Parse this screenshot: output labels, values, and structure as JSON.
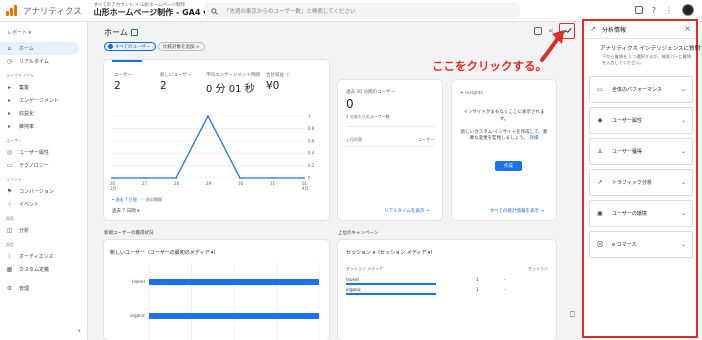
{
  "topbar": {
    "app_name": "アナリティクス",
    "breadcrumb_top": "すべてのアカウント > 山形ホームページ制作",
    "property": "山形ホームページ制作 - GA4 ▾",
    "search_placeholder": "「先週の東京からのユーザー数」と検索してください"
  },
  "sidebar": {
    "report_label": "レポート ▾",
    "items_top": [
      {
        "label": "ホーム",
        "icon": "home-icon",
        "glyph": "⌂"
      },
      {
        "label": "リアルタイム",
        "icon": "clock-icon",
        "glyph": "◷"
      }
    ],
    "section_lifecycle": "ライフサイクル",
    "items_lifecycle": [
      {
        "label": "集客",
        "icon": "acquisition-icon",
        "glyph": "▸"
      },
      {
        "label": "エンゲージメント",
        "icon": "engagement-icon",
        "glyph": "▸"
      },
      {
        "label": "収益化",
        "icon": "monetization-icon",
        "glyph": "▸"
      },
      {
        "label": "維持率",
        "icon": "retention-icon",
        "glyph": "▸"
      }
    ],
    "section_user": "ユーザー",
    "items_user": [
      {
        "label": "ユーザー属性",
        "icon": "globe-icon",
        "glyph": "◎"
      },
      {
        "label": "テクノロジー",
        "icon": "device-icon",
        "glyph": "▭"
      }
    ],
    "section_event": "イベント",
    "items_event": [
      {
        "label": "コンバージョン",
        "icon": "flag-icon",
        "glyph": "⚑"
      },
      {
        "label": "イベント",
        "icon": "touch-icon",
        "glyph": "☝"
      }
    ],
    "section_explore": "探索",
    "items_explore": [
      {
        "label": "分析",
        "icon": "explore-icon",
        "glyph": "◫"
      }
    ],
    "section_config": "設定",
    "items_config": [
      {
        "label": "オーディエンス",
        "icon": "audience-icon",
        "glyph": "⁝"
      },
      {
        "label": "カスタム定義",
        "icon": "custom-definition-icon",
        "glyph": "▦"
      }
    ],
    "admin_label": "管理",
    "admin_glyph": "⚙",
    "collapse_glyph": "‹"
  },
  "main": {
    "title": "ホーム",
    "chip_all_users": "すべてのユーザー",
    "chip_compare": "比較対象を追加 +",
    "metrics": [
      {
        "label": "ユーザー",
        "value": "2"
      },
      {
        "label": "新しいユーザー",
        "value": "2"
      },
      {
        "label": "平均エンゲージメント時間",
        "value": "0 分 01 秒"
      },
      {
        "label": "合計収益 ⓘ",
        "value": "¥0"
      }
    ],
    "legend_current": "━ 過去 7 日間",
    "legend_previous": "‐ ‐ 前の期間",
    "date_range": "過去 7 日間 ▾",
    "realtime_title": "過去 30 分間のユーザー",
    "realtime_value": "0",
    "realtime_sub": "1 分あたりのユーザー数",
    "realtime_col_left": "上位の国",
    "realtime_col_right": "ユーザー",
    "realtime_link": "リアルタイムを表示 →",
    "insights_head": "✦ Insights",
    "insights_text1": "インサイトがまもなくここに表示されます。",
    "insights_text2": "新しいカスタム インサイトを作成して、重要な変更を監視しましょう。",
    "insights_link_word": "詳細",
    "insights_button": "作成",
    "insights_link": "すべての統計情報を表示 →",
    "section_new_users": "新規ユーザーの獲得状況",
    "section_campaign": "上位のキャンペーン",
    "barchart_title": "新しいユーザー（ユーザーの最初のメディア ▾）",
    "table_title": "セッション ▾（セッション メディア ▾）",
    "table_col_left": "セッション メディア",
    "table_col_right": "セッション"
  },
  "chart_data": [
    {
      "type": "line",
      "title": "",
      "x": [
        "01",
        "02",
        "03",
        "04",
        "05",
        "06",
        "07"
      ],
      "x_tick_labels": [
        "26 3月",
        "27",
        "28",
        "29",
        "30",
        "31",
        "01 4月"
      ],
      "series": [
        {
          "name": "過去 7 日間",
          "values": [
            0,
            0,
            0,
            1,
            0,
            0,
            0
          ]
        }
      ],
      "ylim": [
        0,
        1
      ],
      "y_ticks": [
        "0",
        "0.2",
        "0.4",
        "0.6",
        "0.8",
        "1"
      ],
      "line_color": "#1a73e8"
    },
    {
      "type": "bar",
      "title": "新しいユーザー（ユーザーの最初のメディア ▾）",
      "categories": [
        "(none)",
        "organic"
      ],
      "values": [
        1,
        1
      ],
      "xlim": [
        0,
        1
      ],
      "bar_color": "#1a73e8"
    },
    {
      "type": "table",
      "title": "セッション ▾（セッション メディア ▾）",
      "columns": [
        "セッション メディア",
        "セッション"
      ],
      "rows": [
        {
          "label": "(none)",
          "value": "1",
          "change": "-"
        },
        {
          "label": "organic",
          "value": "1",
          "change": "-"
        }
      ]
    }
  ],
  "panel": {
    "title": "分析情報",
    "heading": "アナリティクス インテリジェンスに質問する",
    "description": "下から質問を 1 つ選択するか、検索バーに質問を入力してください。",
    "sections": [
      {
        "label": "全体のパフォーマンス",
        "icon": "monitor-icon",
        "glyph": "▭"
      },
      {
        "label": "ユーザー属性",
        "icon": "globe-icon",
        "glyph": "◉"
      },
      {
        "label": "ユーザー獲得",
        "icon": "user-icon",
        "glyph": "♙"
      },
      {
        "label": "トラフィック分析",
        "icon": "trend-icon",
        "glyph": "↗"
      },
      {
        "label": "ユーザーの環境",
        "icon": "devices-icon",
        "glyph": "▣"
      },
      {
        "label": "e コマース",
        "icon": "cart-icon",
        "glyph": "⛒"
      }
    ]
  },
  "annotation": {
    "text": "ここをクリックする。",
    "color": "#e8281c"
  }
}
